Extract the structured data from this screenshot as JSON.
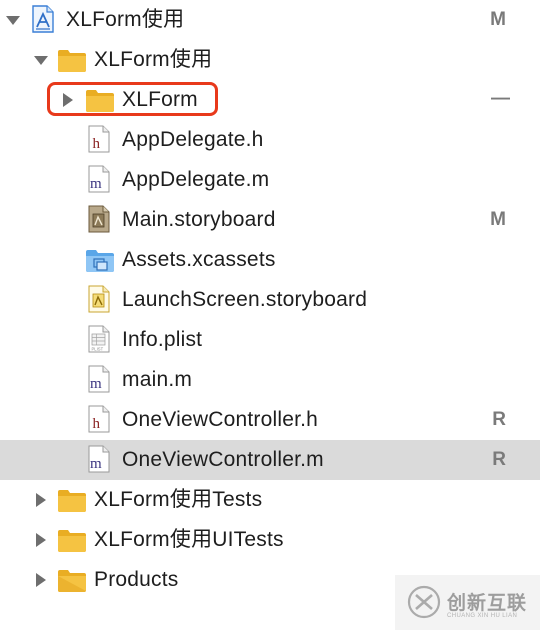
{
  "tree": {
    "project": {
      "label": "XLForm使用",
      "badge": "M"
    },
    "group_main": {
      "label": "XLForm使用"
    },
    "folder_xlform": {
      "label": "XLForm",
      "badge": "—"
    },
    "files": [
      {
        "label": "AppDelegate.h",
        "badge": ""
      },
      {
        "label": "AppDelegate.m",
        "badge": ""
      },
      {
        "label": "Main.storyboard",
        "badge": "M"
      },
      {
        "label": "Assets.xcassets",
        "badge": ""
      },
      {
        "label": "LaunchScreen.storyboard",
        "badge": ""
      },
      {
        "label": "Info.plist",
        "badge": ""
      },
      {
        "label": "main.m",
        "badge": ""
      },
      {
        "label": "OneViewController.h",
        "badge": "R"
      },
      {
        "label": "OneViewController.m",
        "badge": "R"
      }
    ],
    "tests": {
      "label": "XLForm使用Tests"
    },
    "uitests": {
      "label": "XLForm使用UITests"
    },
    "products": {
      "label": "Products"
    }
  },
  "icons": {
    "header_file": "h",
    "impl_file": "m",
    "plist_text": "PLIST"
  },
  "watermark": {
    "text": "创新互联",
    "sub": "CHUANG XIN HU LIAN"
  },
  "colors": {
    "folder": "#f5c342",
    "folder_dark": "#e9ad23",
    "selection": "#dadada",
    "highlight": "#e8391b",
    "header_h": "#8b2323",
    "impl_m": "#3b3480"
  }
}
